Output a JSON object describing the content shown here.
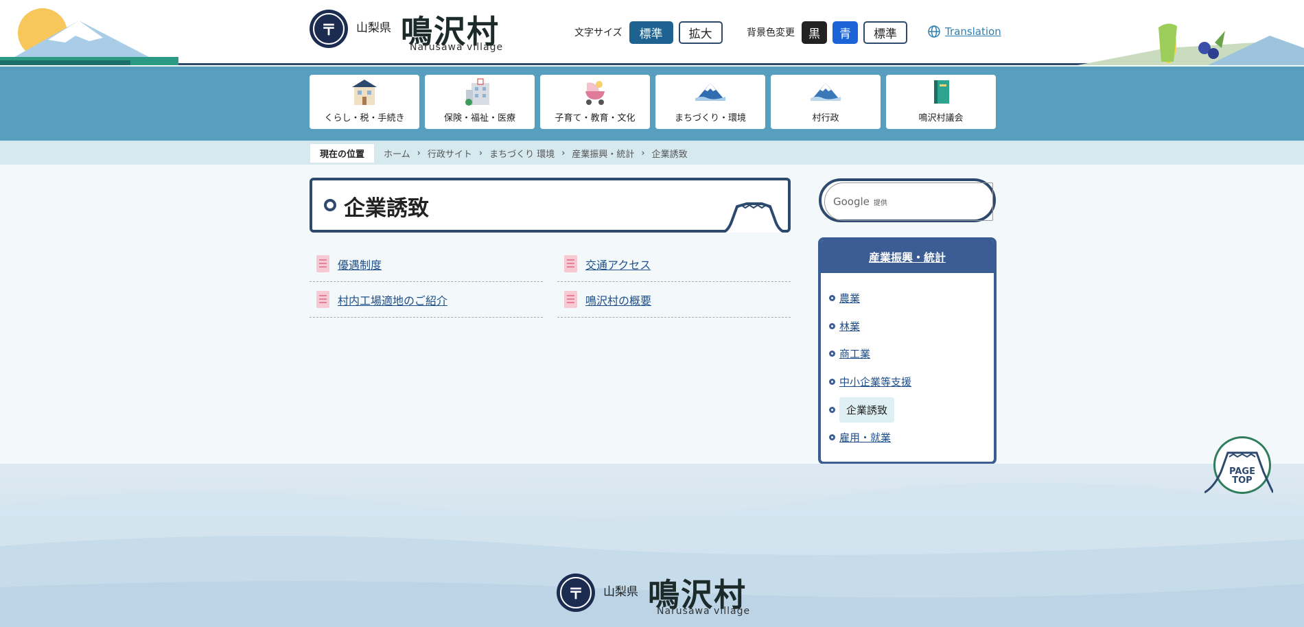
{
  "header": {
    "logo": {
      "prefecture": "山梨県",
      "village": "鳴沢村",
      "roman": "Narusawa village"
    },
    "font_size": {
      "label": "文字サイズ",
      "standard": "標準",
      "large": "拡大"
    },
    "bg_color": {
      "label": "背景色変更",
      "black": "黒",
      "blue": "青",
      "standard": "標準"
    },
    "translation": "Translation"
  },
  "nav": {
    "items": [
      {
        "label": "くらし・税・手続き"
      },
      {
        "label": "保険・福祉・医療"
      },
      {
        "label": "子育て・教育・文化"
      },
      {
        "label": "まちづくり・環境"
      },
      {
        "label": "村行政"
      },
      {
        "label": "鳴沢村議会"
      }
    ]
  },
  "breadcrumb": {
    "here_label": "現在の位置",
    "items": [
      "ホーム",
      "行政サイト",
      "まちづくり 環境",
      "産業振興・統計"
    ],
    "current": "企業誘致"
  },
  "main": {
    "title": "企業誘致",
    "links": [
      "優遇制度",
      "交通アクセス",
      "村内工場適地のご紹介",
      "鳴沢村の概要"
    ]
  },
  "search": {
    "google": "Google",
    "provided": "提供"
  },
  "sidebar": {
    "heading": "産業振興・統計",
    "items": [
      "農業",
      "林業",
      "商工業",
      "中小企業等支援",
      "企業誘致",
      "雇用・就業"
    ],
    "current_index": 4
  },
  "footer": {
    "logo": {
      "prefecture": "山梨県",
      "village": "鳴沢村",
      "roman": "Narusawa village"
    }
  },
  "pagetop": {
    "line1": "PAGE",
    "line2": "TOP"
  },
  "colors": {
    "header_border": "#2d4a6e",
    "nav_band": "#589fbf",
    "active_button": "#1d6290",
    "link": "#1f4f8a"
  }
}
